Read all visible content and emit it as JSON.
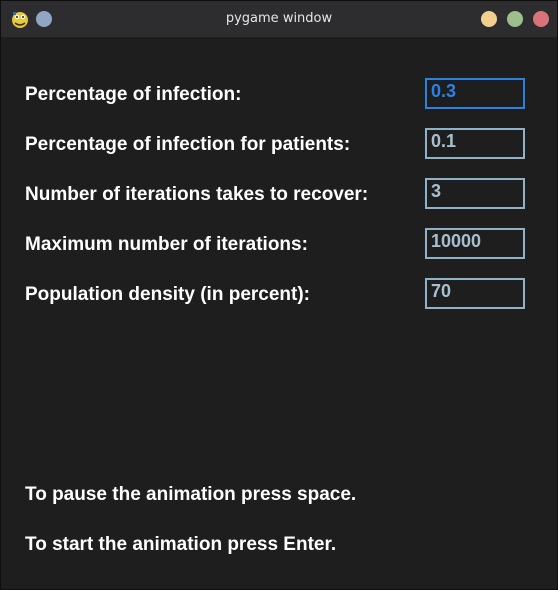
{
  "window": {
    "title": "pygame window"
  },
  "form": {
    "fields": [
      {
        "label": "Percentage of infection:",
        "value": "0.3",
        "active": true
      },
      {
        "label": "Percentage of infection for patients:",
        "value": "0.1",
        "active": false
      },
      {
        "label": "Number of iterations takes to recover:",
        "value": "3",
        "active": false
      },
      {
        "label": "Maximum number of iterations:",
        "value": "10000",
        "active": false
      },
      {
        "label": "Population density (in percent):",
        "value": "70",
        "active": false
      }
    ]
  },
  "instructions": {
    "pause": "To pause the animation press space.",
    "start": "To start the animation press Enter."
  },
  "colors": {
    "background": "#1e1e1f",
    "titlebar": "#2d2d30",
    "active_border": "#2a82e6",
    "inactive_border": "#8eb3c9",
    "text": "#ffffff"
  }
}
